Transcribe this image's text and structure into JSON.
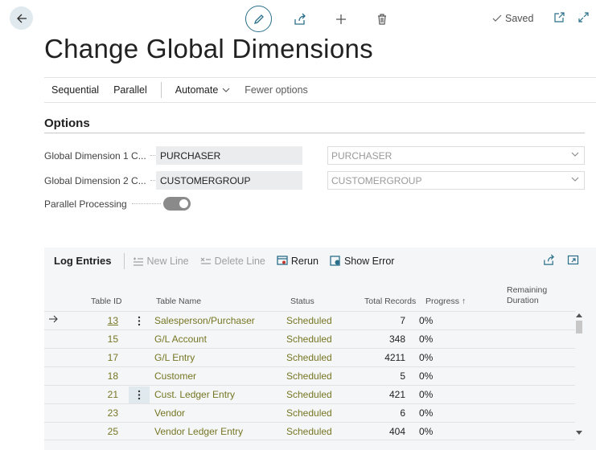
{
  "page": {
    "title": "Change Global Dimensions",
    "saved_label": "Saved"
  },
  "action_bar": {
    "items": [
      {
        "label": "Sequential"
      },
      {
        "label": "Parallel"
      },
      {
        "label": "Automate"
      },
      {
        "label": "Fewer options"
      }
    ]
  },
  "options": {
    "section_title": "Options",
    "fields": [
      {
        "label": "Global Dimension 1 C...",
        "current_value": "PURCHASER",
        "new_value": "PURCHASER"
      },
      {
        "label": "Global Dimension 2 C...",
        "current_value": "CUSTOMERGROUP",
        "new_value": "CUSTOMERGROUP"
      }
    ],
    "parallel_label": "Parallel Processing",
    "parallel_enabled": true
  },
  "log": {
    "title": "Log Entries",
    "actions": {
      "new_line": "New Line",
      "delete_line": "Delete Line",
      "rerun": "Rerun",
      "show_error": "Show Error"
    },
    "columns": {
      "table_id": "Table ID",
      "table_name": "Table Name",
      "status": "Status",
      "total_records": "Total Records",
      "progress": "Progress",
      "progress_sort": "↑",
      "remaining_1": "Remaining",
      "remaining_2": "Duration"
    },
    "rows": [
      {
        "id": "13",
        "name": "Salesperson/Purchaser",
        "status": "Scheduled",
        "records": "7",
        "progress": "0%"
      },
      {
        "id": "15",
        "name": "G/L Account",
        "status": "Scheduled",
        "records": "348",
        "progress": "0%"
      },
      {
        "id": "17",
        "name": "G/L Entry",
        "status": "Scheduled",
        "records": "4211",
        "progress": "0%"
      },
      {
        "id": "18",
        "name": "Customer",
        "status": "Scheduled",
        "records": "5",
        "progress": "0%"
      },
      {
        "id": "21",
        "name": "Cust. Ledger Entry",
        "status": "Scheduled",
        "records": "421",
        "progress": "0%"
      },
      {
        "id": "23",
        "name": "Vendor",
        "status": "Scheduled",
        "records": "6",
        "progress": "0%"
      },
      {
        "id": "25",
        "name": "Vendor Ledger Entry",
        "status": "Scheduled",
        "records": "404",
        "progress": "0%"
      }
    ]
  },
  "colors": {
    "accent": "#2a6f8a",
    "link_olive": "#767624",
    "panel_bg": "#f5f6f7"
  }
}
